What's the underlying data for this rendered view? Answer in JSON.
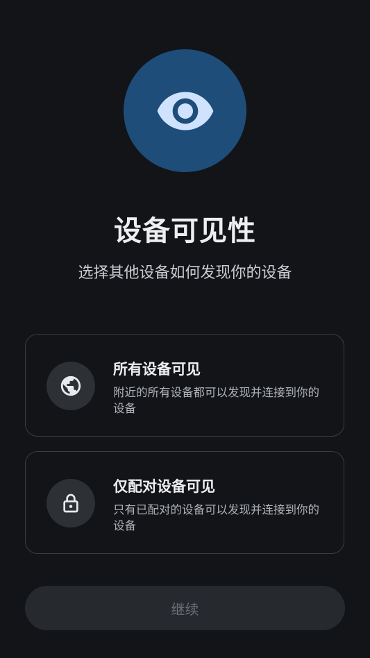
{
  "header": {
    "icon": "eye-icon",
    "title": "设备可见性",
    "subtitle": "选择其他设备如何发现你的设备"
  },
  "options": [
    {
      "icon": "globe-icon",
      "title": "所有设备可见",
      "description": "附近的所有设备都可以发现并连接到你的设备"
    },
    {
      "icon": "lock-icon",
      "title": "仅配对设备可见",
      "description": "只有已配对的设备可以发现并连接到你的设备"
    }
  ],
  "footer": {
    "continue_label": "继续"
  },
  "colors": {
    "background": "#121418",
    "hero_circle": "#1f4d7a",
    "icon_accent": "#cfe3ff",
    "card_border": "#3a3d43",
    "button_disabled_bg": "#26292e",
    "button_disabled_text": "#6c7077"
  }
}
